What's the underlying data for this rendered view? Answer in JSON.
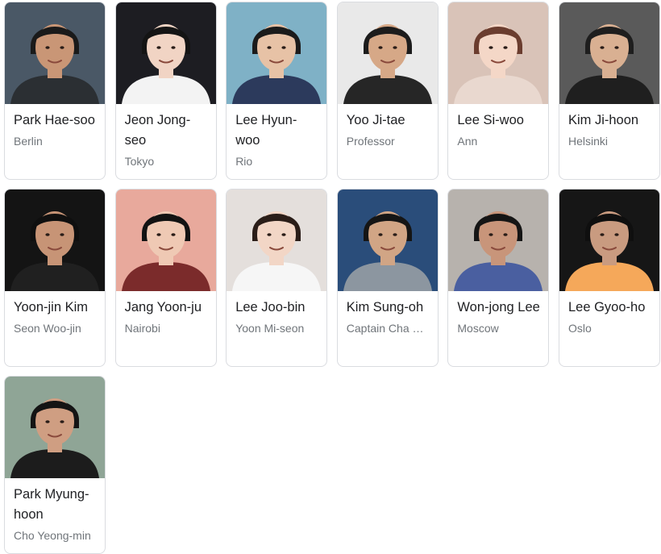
{
  "cast": [
    {
      "name": "Park Hae-soo",
      "role": "Berlin",
      "bg": "#4a5866",
      "skin": "#c99676",
      "hair": "#1a1a1a",
      "shirt": "#2b2f33"
    },
    {
      "name": "Jeon Jong-seo",
      "role": "Tokyo",
      "bg": "#1d1d22",
      "skin": "#f1d4c4",
      "hair": "#141414",
      "shirt": "#f3f3f3"
    },
    {
      "name": "Lee Hyun-woo",
      "role": "Rio",
      "bg": "#7fb1c6",
      "skin": "#e7c2a6",
      "hair": "#1b1b1b",
      "shirt": "#2c3a5c"
    },
    {
      "name": "Yoo Ji-tae",
      "role": "Professor",
      "bg": "#e9e9e9",
      "skin": "#d6a887",
      "hair": "#1c1c1c",
      "shirt": "#262626"
    },
    {
      "name": "Lee Si-woo",
      "role": "Ann",
      "bg": "#d9c3b8",
      "skin": "#f4d7c7",
      "hair": "#6b3d2f",
      "shirt": "#e9d8cf"
    },
    {
      "name": "Kim Ji-hoon",
      "role": "Helsinki",
      "bg": "#5a5a5a",
      "skin": "#d9b092",
      "hair": "#1e1e1e",
      "shirt": "#1f1f1f"
    },
    {
      "name": "Yoon-jin Kim",
      "role": "Seon Woo-jin",
      "bg": "#141414",
      "skin": "#c79476",
      "hair": "#0f0f0f",
      "shirt": "#202020"
    },
    {
      "name": "Jang Yoon-ju",
      "role": "Nairobi",
      "bg": "#e8a99c",
      "skin": "#efc9b4",
      "hair": "#121212",
      "shirt": "#7b2b2b"
    },
    {
      "name": "Lee Joo-bin",
      "role": "Yoon Mi-seon",
      "bg": "#e4dfdc",
      "skin": "#f2d6c6",
      "hair": "#2a1d18",
      "shirt": "#f6f6f6"
    },
    {
      "name": "Kim Sung-oh",
      "role": "Captain Cha …",
      "bg": "#2a4d7a",
      "skin": "#d1a585",
      "hair": "#151515",
      "shirt": "#8c96a0"
    },
    {
      "name": "Won-jong Lee",
      "role": "Moscow",
      "bg": "#b7b2ad",
      "skin": "#c8957a",
      "hair": "#151515",
      "shirt": "#4a5fa0"
    },
    {
      "name": "Lee Gyoo-ho",
      "role": "Oslo",
      "bg": "#161616",
      "skin": "#c99b80",
      "hair": "#0f0f0f",
      "shirt": "#f5a85a"
    },
    {
      "name": "Park Myung-hoon",
      "role": "Cho Yeong-min",
      "bg": "#8fa596",
      "skin": "#cf9e82",
      "hair": "#141414",
      "shirt": "#1c1c1c"
    }
  ]
}
